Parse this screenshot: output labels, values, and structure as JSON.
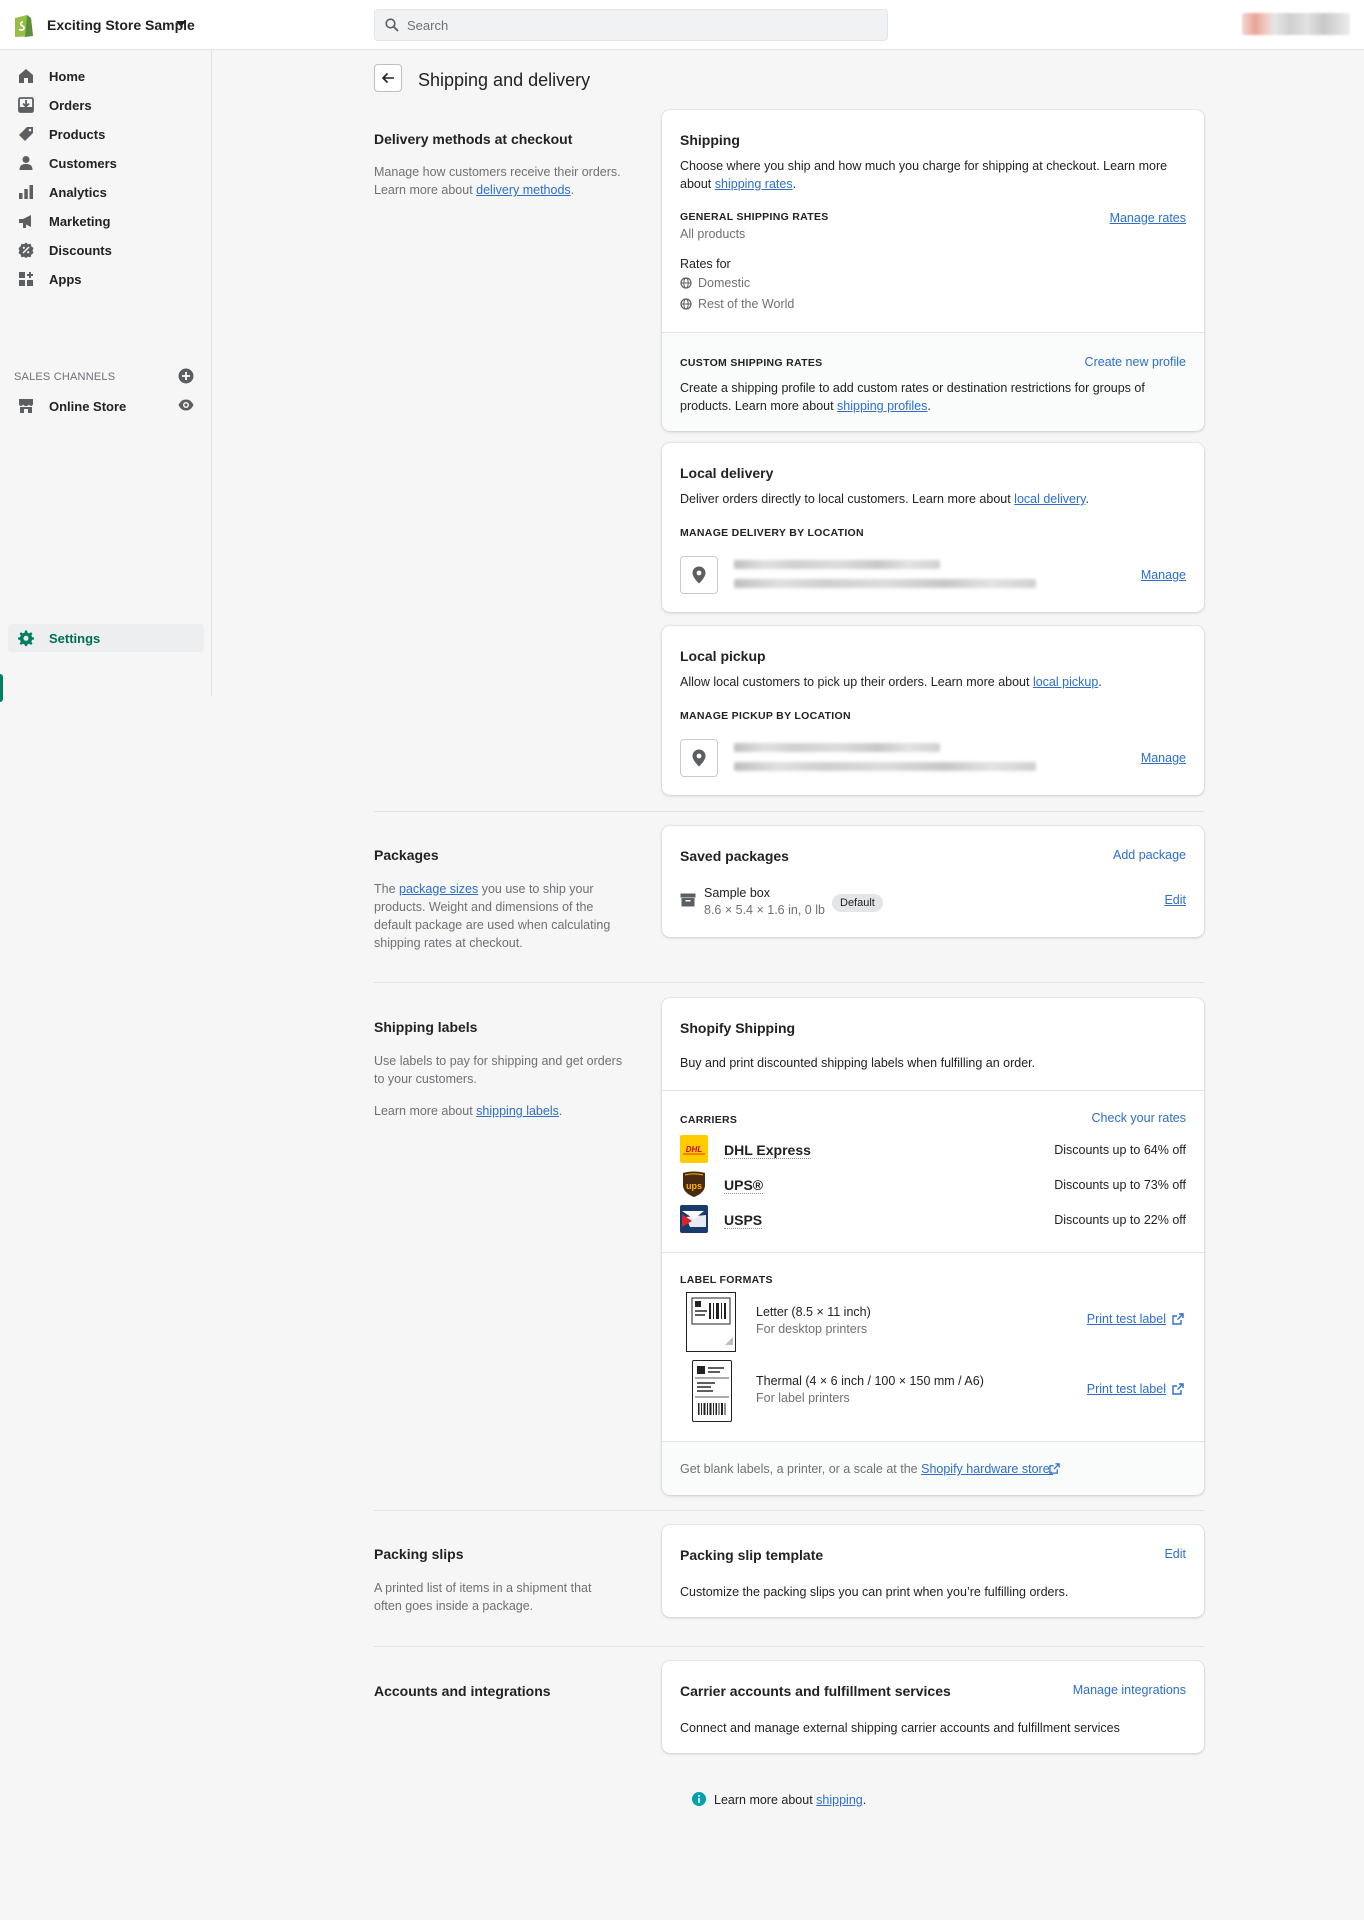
{
  "topbar": {
    "store_name": "Exciting Store Sample",
    "search_placeholder": "Search"
  },
  "sidebar": {
    "items": [
      {
        "label": "Home",
        "icon": "home-icon"
      },
      {
        "label": "Orders",
        "icon": "orders-icon"
      },
      {
        "label": "Products",
        "icon": "tag-icon"
      },
      {
        "label": "Customers",
        "icon": "person-icon"
      },
      {
        "label": "Analytics",
        "icon": "bar-chart-icon"
      },
      {
        "label": "Marketing",
        "icon": "megaphone-icon"
      },
      {
        "label": "Discounts",
        "icon": "discount-icon"
      },
      {
        "label": "Apps",
        "icon": "apps-icon"
      }
    ],
    "channels_title": "SALES CHANNELS",
    "online_store": "Online Store",
    "settings": "Settings",
    "accent_color": "#008060"
  },
  "page": {
    "title": "Shipping and delivery"
  },
  "delivery": {
    "title": "Delivery methods at checkout",
    "desc_prefix": "Manage how customers receive their orders. Learn more about ",
    "desc_link": "delivery methods",
    "desc_suffix": "."
  },
  "shipping_card": {
    "title": "Shipping",
    "desc_prefix": "Choose where you ship and how much you charge for shipping at checkout. Learn more about ",
    "desc_link": "shipping rates",
    "desc_suffix": ".",
    "general_title": "GENERAL SHIPPING RATES",
    "general_sub": "All products",
    "manage_rates": "Manage rates",
    "rates_for": "Rates for",
    "zones": [
      "Domestic",
      "Rest of the World"
    ],
    "custom_title": "CUSTOM SHIPPING RATES",
    "create_profile": "Create new profile",
    "custom_desc_prefix": "Create a shipping profile to add custom rates or destination restrictions for groups of products. Learn more about ",
    "custom_desc_link": "shipping profiles",
    "custom_desc_suffix": "."
  },
  "local_delivery": {
    "title": "Local delivery",
    "desc_prefix": "Deliver orders directly to local customers. Learn more about ",
    "desc_link": "local delivery",
    "desc_suffix": ".",
    "sub": "MANAGE DELIVERY BY LOCATION",
    "manage": "Manage"
  },
  "local_pickup": {
    "title": "Local pickup",
    "desc_prefix": "Allow local customers to pick up their orders. Learn more about ",
    "desc_link": "local pickup",
    "desc_suffix": ".",
    "sub": "MANAGE PICKUP BY LOCATION",
    "manage": "Manage"
  },
  "packages": {
    "title": "Packages",
    "desc_prefix": "The ",
    "desc_link": "package sizes",
    "desc_suffix": " you use to ship your products. Weight and dimensions of the default package are used when calculating shipping rates at checkout.",
    "card_title": "Saved packages",
    "add": "Add package",
    "item_name": "Sample box",
    "item_dims": "8.6 × 5.4 × 1.6 in, 0 lb",
    "badge": "Default",
    "edit": "Edit"
  },
  "labels": {
    "title": "Shipping labels",
    "desc1": "Use labels to pay for shipping and get orders to your customers.",
    "desc2_prefix": "Learn more about ",
    "desc2_link": "shipping labels",
    "desc2_suffix": ".",
    "card_title": "Shopify Shipping",
    "card_desc": "Buy and print discounted shipping labels when fulfilling an order.",
    "carriers_title": "CARRIERS",
    "check_rates": "Check your rates",
    "carriers": [
      {
        "name": "DHL Express",
        "discount": "Discounts up to 64% off",
        "color": "#ffcc00"
      },
      {
        "name": "UPS®",
        "discount": "Discounts up to 73% off",
        "color": "#5a3a1a"
      },
      {
        "name": "USPS",
        "discount": "Discounts up to 22% off",
        "color": "#1a3a6c"
      }
    ],
    "formats_title": "LABEL FORMATS",
    "formats": [
      {
        "name": "Letter (8.5 × 11 inch)",
        "sub": "For desktop printers",
        "action": "Print test label"
      },
      {
        "name": "Thermal (4 × 6 inch / 100 × 150 mm / A6)",
        "sub": "For label printers",
        "action": "Print test label"
      }
    ],
    "footer_prefix": "Get blank labels, a printer, or a scale at the ",
    "footer_link": "Shopify hardware store."
  },
  "slips": {
    "title": "Packing slips",
    "desc": "A printed list of items in a shipment that often goes inside a package.",
    "card_title": "Packing slip template",
    "edit": "Edit",
    "card_desc": "Customize the packing slips you can print when you’re fulfilling orders."
  },
  "accounts": {
    "title": "Accounts and integrations",
    "card_title": "Carrier accounts and fulfillment services",
    "manage": "Manage integrations",
    "card_desc": "Connect and manage external shipping carrier accounts and fulfillment services"
  },
  "footer": {
    "prefix": "Learn more about ",
    "link": "shipping",
    "suffix": "."
  }
}
